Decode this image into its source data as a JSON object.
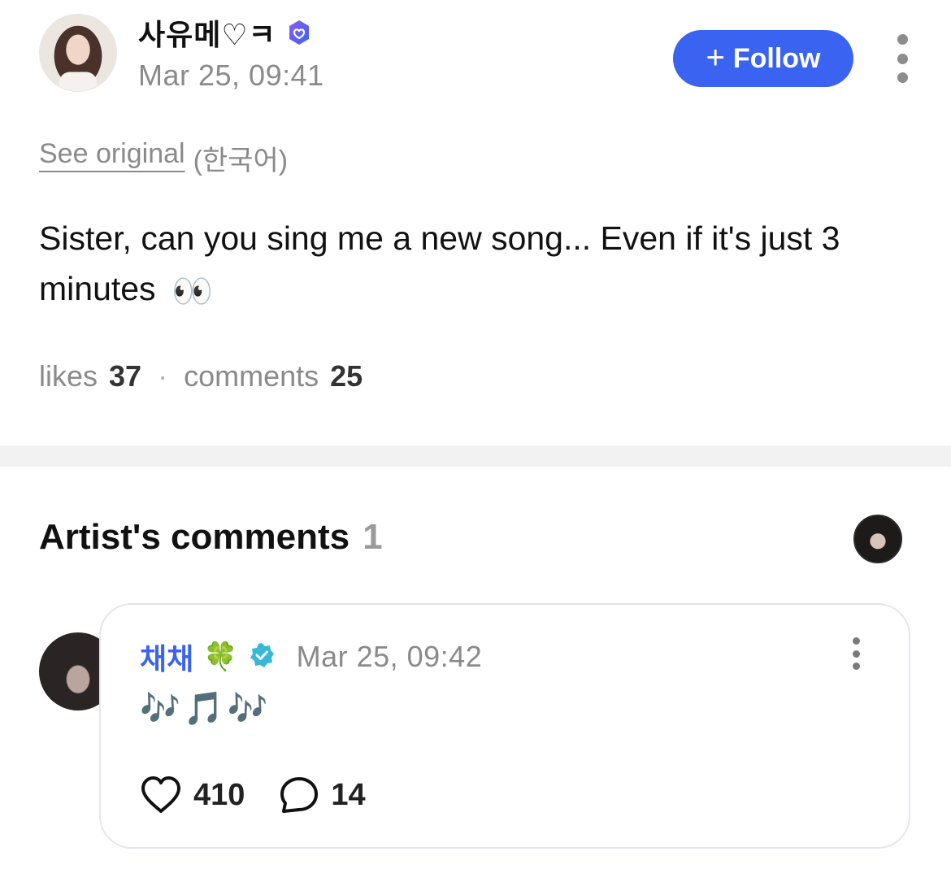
{
  "post": {
    "author_name": "사유메♡ㅋ",
    "timestamp": "Mar 25, 09:41",
    "follow_label": "Follow",
    "see_original_link": "See original",
    "original_language": "(한국어)",
    "body_text": "Sister, can you sing me a new song... Even if it's just 3 minutes",
    "body_emoji": "👀",
    "likes_label": "likes",
    "likes_count": "37",
    "separator": "·",
    "comments_label": "comments",
    "comments_count": "25"
  },
  "artist_comments": {
    "title": "Artist's comments",
    "count": "1"
  },
  "comment": {
    "author_name": "채채",
    "author_emoji": "🍀",
    "timestamp": "Mar 25, 09:42",
    "text": "🎶🎵🎶",
    "likes": "410",
    "replies": "14"
  },
  "colors": {
    "accent_blue": "#3a63f2",
    "muted_text": "#8a8a8a",
    "verified_teal": "#37b8d6",
    "verified_purple_gradient": [
      "#7a5cf0",
      "#3a63f2"
    ]
  },
  "icons": {
    "more": "more-vertical-icon",
    "verified": "verified-badge-icon",
    "like": "heart-outline-icon",
    "reply": "speech-bubble-icon",
    "plus": "plus-icon"
  }
}
